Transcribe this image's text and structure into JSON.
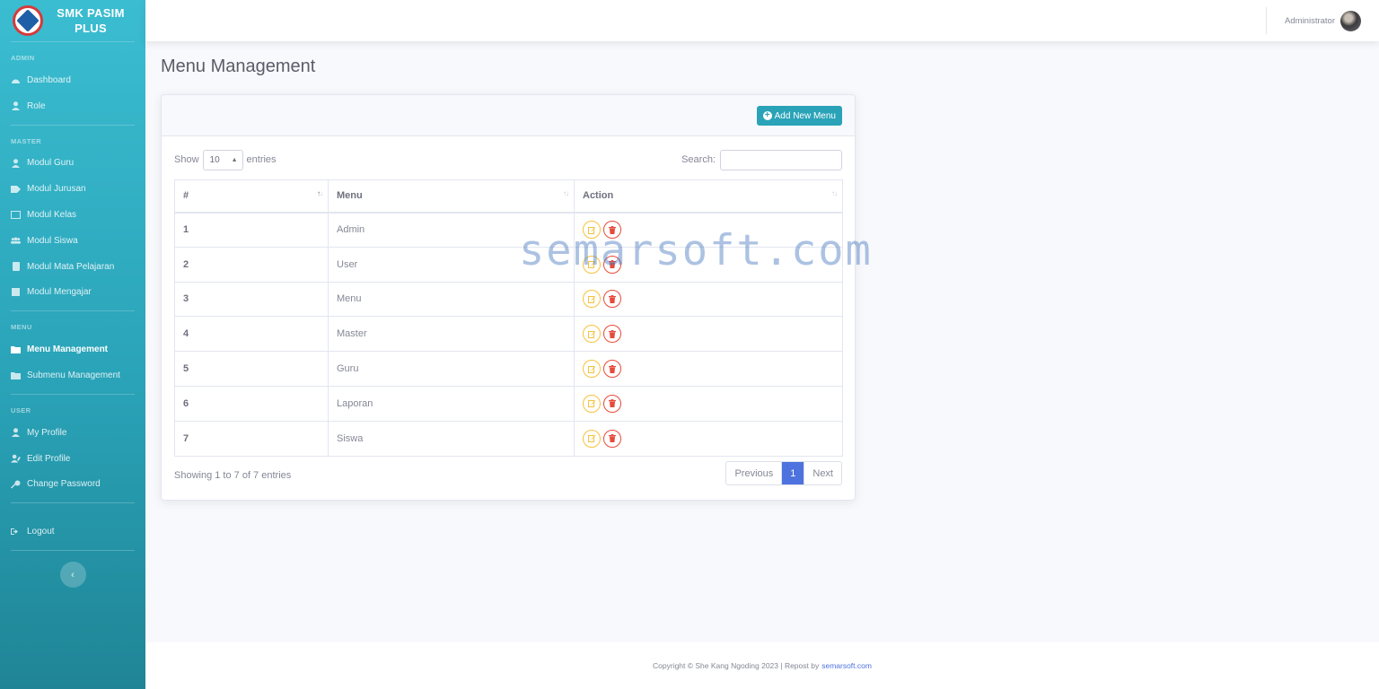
{
  "brand": {
    "line1": "SMK PASIM",
    "line2": "PLUS"
  },
  "sidebar": {
    "sections": [
      {
        "heading": "ADMIN",
        "items": [
          {
            "label": "Dashboard",
            "icon": "tachometer-icon"
          },
          {
            "label": "Role",
            "icon": "user-icon"
          }
        ]
      },
      {
        "heading": "MASTER",
        "items": [
          {
            "label": "Modul Guru",
            "icon": "user-tie-icon"
          },
          {
            "label": "Modul Jurusan",
            "icon": "tag-icon"
          },
          {
            "label": "Modul Kelas",
            "icon": "chalkboard-icon"
          },
          {
            "label": "Modul Siswa",
            "icon": "users-icon"
          },
          {
            "label": "Modul Mata Pelajaran",
            "icon": "book-icon"
          },
          {
            "label": "Modul Mengajar",
            "icon": "list-icon"
          }
        ]
      },
      {
        "heading": "MENU",
        "items": [
          {
            "label": "Menu Management",
            "icon": "folder-icon",
            "active": true
          },
          {
            "label": "Submenu Management",
            "icon": "folder-open-icon"
          }
        ]
      },
      {
        "heading": "USER",
        "items": [
          {
            "label": "My Profile",
            "icon": "user-icon"
          },
          {
            "label": "Edit Profile",
            "icon": "user-edit-icon"
          },
          {
            "label": "Change Password",
            "icon": "key-icon"
          }
        ]
      }
    ],
    "logout": "Logout",
    "toggle": "‹"
  },
  "topbar": {
    "username": "Administrator"
  },
  "main": {
    "title": "Menu Management",
    "add_button": "Add New Menu",
    "show_label": "Show",
    "entries_label": "entries",
    "page_length": "10",
    "search_label": "Search:",
    "search_value": "",
    "columns": [
      "#",
      "Menu",
      "Action"
    ],
    "rows": [
      {
        "num": "1",
        "menu": "Admin"
      },
      {
        "num": "2",
        "menu": "User"
      },
      {
        "num": "3",
        "menu": "Menu"
      },
      {
        "num": "4",
        "menu": "Master"
      },
      {
        "num": "5",
        "menu": "Guru"
      },
      {
        "num": "6",
        "menu": "Laporan"
      },
      {
        "num": "7",
        "menu": "Siswa"
      }
    ],
    "info": "Showing 1 to 7 of 7 entries",
    "pagination": {
      "prev": "Previous",
      "current": "1",
      "next": "Next"
    }
  },
  "watermark": "semarsoft.com",
  "footer": {
    "text": "Copyright © She Kang Ngoding 2023 | Repost by",
    "link": "semarsoft.com"
  },
  "colors": {
    "sidebar": "#2aa3b8",
    "primary": "#4e73df",
    "warning": "#f6c23e",
    "danger": "#e74a3b"
  }
}
